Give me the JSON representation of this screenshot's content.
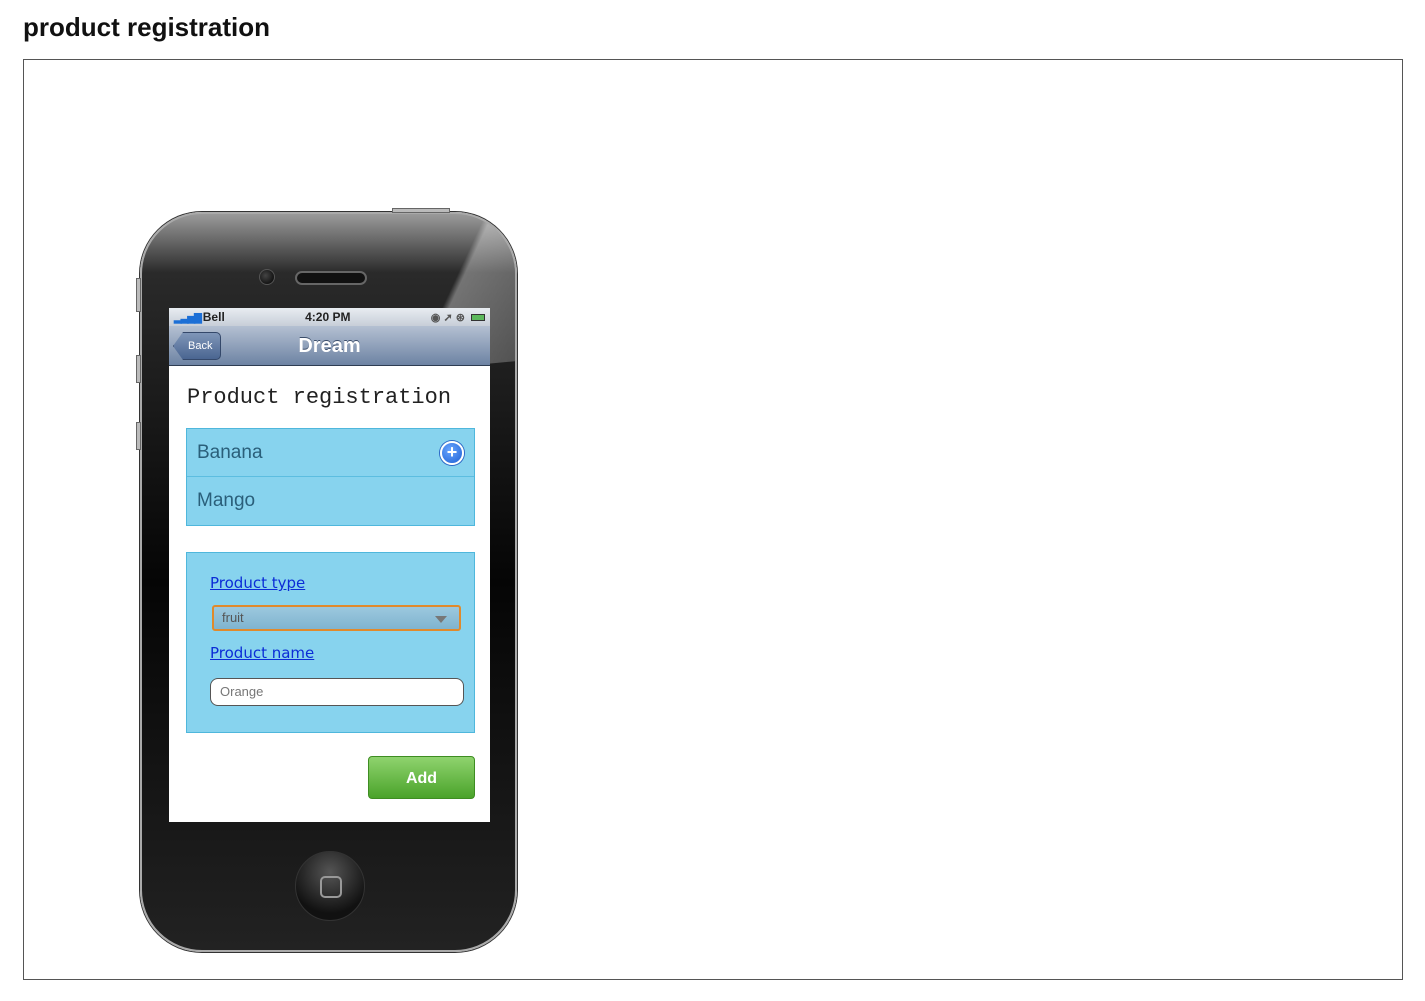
{
  "page": {
    "title": "product registration"
  },
  "status_bar": {
    "carrier": "Bell",
    "time": "4:20 PM"
  },
  "nav": {
    "back_label": "Back",
    "title": "Dream"
  },
  "content": {
    "heading": "Product registration"
  },
  "list": {
    "items": [
      {
        "label": "Banana"
      },
      {
        "label": "Mango"
      }
    ]
  },
  "form": {
    "type_label": "Product type",
    "type_value": "fruit",
    "name_label": "Product name",
    "name_placeholder": "Orange"
  },
  "actions": {
    "add_label": "Add"
  },
  "colors": {
    "list_bg": "#87d3ee",
    "add_button": "#5fb83c",
    "link": "#0b2cd6"
  }
}
